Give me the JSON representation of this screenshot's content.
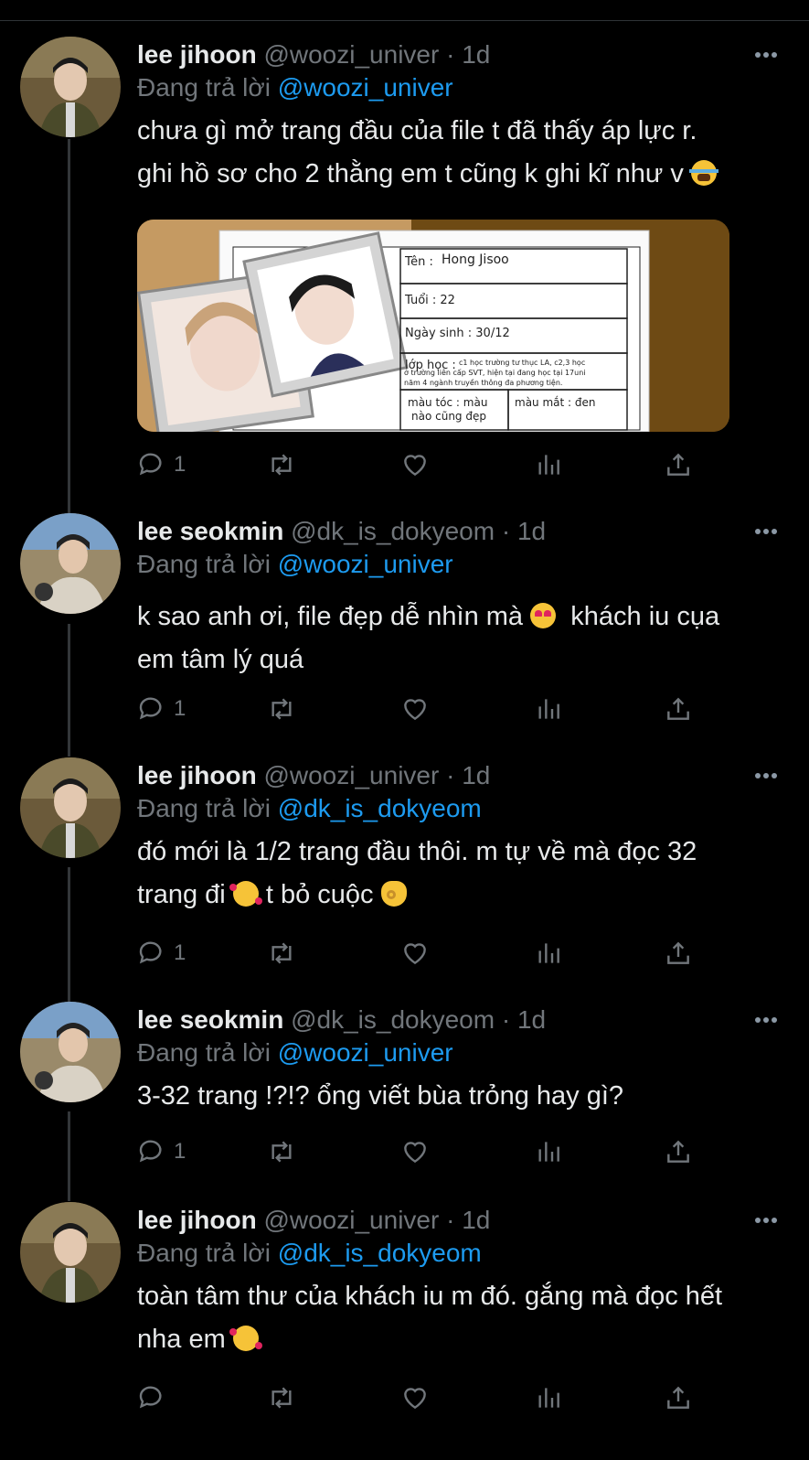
{
  "tweets": [
    {
      "name": "lee jihoon",
      "handle": "@woozi_univer",
      "time": "· 1d",
      "reply_prefix": "Đang trả lời",
      "reply_to": "@woozi_univer",
      "lines": [
        "chưa gì mở trang đầu của file t đã thấy áp lực r.",
        "ghi hồ sơ cho 2 thằng em t cũng k ghi kĩ như v"
      ],
      "emoji": [
        "loudly-crying-face"
      ],
      "replies": "1",
      "media": {
        "fields": {
          "name": "Tên :",
          "name_value": "Hong Jisoo",
          "age": "Tuổi : 22",
          "dob": "Ngày sinh : 30/12",
          "class_label": "lớp học :",
          "class_value_1": "c1 học trường tư thục LA, c2,3 học",
          "class_value_2": "ở trường liên cấp SVT, hiện tại đang học tại 17uni",
          "class_value_3": "năm 4 ngành truyền thông đa phương tiện.",
          "hair": "màu tóc : màu",
          "hair2": "nào cũng đẹp",
          "eyes": "màu mắt : đen"
        }
      }
    },
    {
      "name": "lee seokmin",
      "handle": "@dk_is_dokyeom",
      "time": "· 1d",
      "reply_prefix": "Đang trả lời",
      "reply_to": "@woozi_univer",
      "lines": [
        "k sao anh ơi, file đẹp dễ nhìn mà",
        "khách iu cụa",
        "em tâm lý quá"
      ],
      "emoji": [
        "smiling-face-with-heart-eyes"
      ],
      "replies": "1"
    },
    {
      "name": "lee jihoon",
      "handle": "@woozi_univer",
      "time": "· 1d",
      "reply_prefix": "Đang trả lời",
      "reply_to": "@dk_is_dokyeom",
      "lines": [
        "đó mới là 1/2 trang đầu thôi. m tự về mà đọc 32",
        "trang đi",
        "t bỏ cuộc"
      ],
      "emoji": [
        "smiling-face-with-hearts",
        "ok-hand"
      ],
      "replies": "1"
    },
    {
      "name": "lee seokmin",
      "handle": "@dk_is_dokyeom",
      "time": "· 1d",
      "reply_prefix": "Đang trả lời",
      "reply_to": "@woozi_univer",
      "lines": [
        "3-32 trang !?!? ổng viết bùa trỏng hay gì?"
      ],
      "replies": "1"
    },
    {
      "name": "lee jihoon",
      "handle": "@woozi_univer",
      "time": "· 1d",
      "reply_prefix": "Đang trả lời",
      "reply_to": "@dk_is_dokyeom",
      "lines": [
        "toàn tâm thư của khách iu m đó. gắng mà đọc hết",
        "nha em"
      ],
      "emoji": [
        "smiling-face-with-hearts"
      ],
      "replies": ""
    }
  ],
  "colors": {
    "background": "#000000",
    "text": "#e7e9ea",
    "muted": "#71767b",
    "link": "#1d9bf0"
  },
  "icons": [
    "reply-icon",
    "retweet-icon",
    "like-icon",
    "views-icon",
    "share-icon",
    "more-icon"
  ]
}
